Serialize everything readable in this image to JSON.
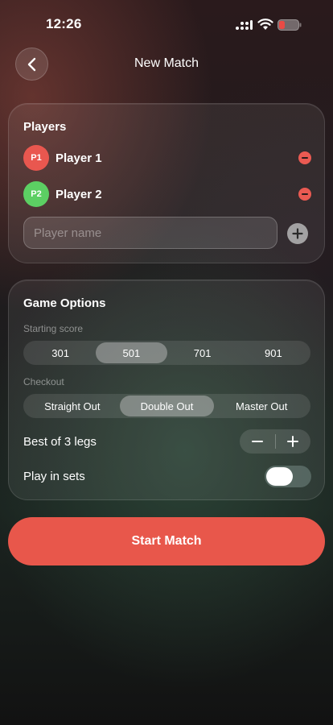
{
  "status_bar": {
    "time": "12:26"
  },
  "header": {
    "title": "New Match"
  },
  "players": {
    "title": "Players",
    "list": [
      {
        "badge": "P1",
        "name": "Player 1",
        "color": "#e9574f"
      },
      {
        "badge": "P2",
        "name": "Player 2",
        "color": "#5ccf63"
      }
    ],
    "input_placeholder": "Player name"
  },
  "options": {
    "title": "Game Options",
    "starting_score": {
      "label": "Starting score",
      "options": [
        "301",
        "501",
        "701",
        "901"
      ],
      "selected": "501"
    },
    "checkout": {
      "label": "Checkout",
      "options": [
        "Straight Out",
        "Double Out",
        "Master Out"
      ],
      "selected": "Double Out"
    },
    "legs": {
      "label": "Best of 3 legs"
    },
    "sets": {
      "label": "Play in sets",
      "enabled": false
    }
  },
  "start_button": {
    "label": "Start Match",
    "color": "#e8574b"
  }
}
